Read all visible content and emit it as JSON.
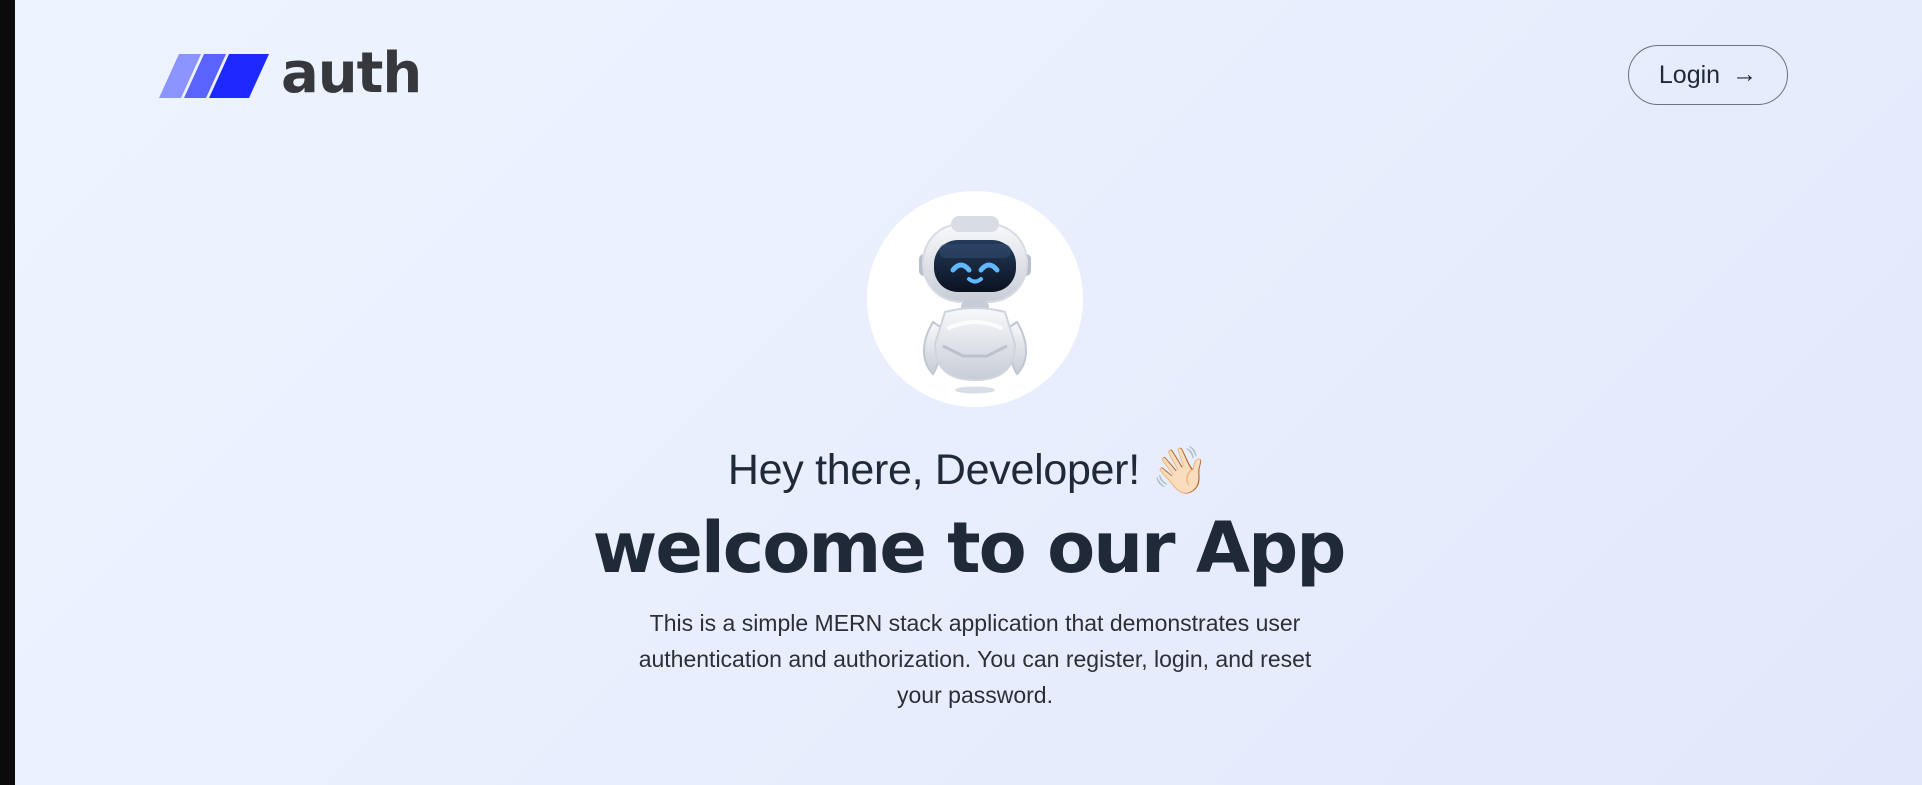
{
  "header": {
    "logo_text": "auth",
    "login_label": "Login",
    "login_icon": "arrow-right-icon"
  },
  "hero": {
    "robot_icon": "robot-illustration",
    "greeting": "Hey there, Developer!",
    "wave_emoji": "👋🏻",
    "title": "welcome to our App",
    "description": "This is a simple MERN stack application that demonstrates user authentication and authorization. You can register, login, and reset your password."
  },
  "colors": {
    "brand_primary": "#1d29ff",
    "brand_secondary": "#5a63ff",
    "brand_tertiary": "#8892ff",
    "text_dark": "#1f2937",
    "text_mid": "#2b2f36",
    "background_start": "#eef4ff",
    "background_end": "#e2e8fb"
  }
}
